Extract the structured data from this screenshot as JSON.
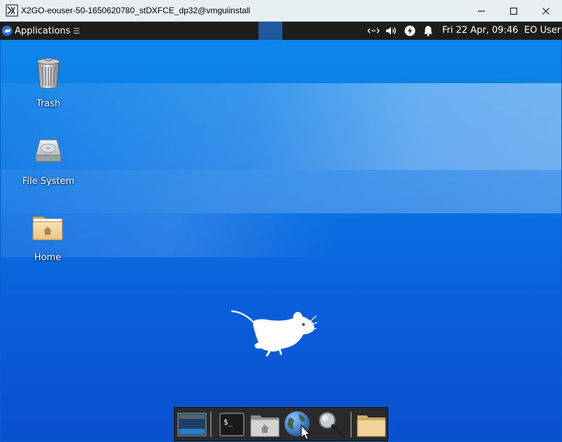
{
  "window": {
    "title": "X2GO-eouser-50-1650620780_stDXFCE_dp32@vmguiinstall",
    "controls": [
      "minimize",
      "maximize",
      "close"
    ]
  },
  "panel": {
    "applications_label": "Applications",
    "menu_glyph": "☰",
    "clock": "Fri 22 Apr, 09:46",
    "user": "EO User",
    "tray_icons": [
      "network-icon",
      "volume-icon",
      "power-icon",
      "notification-bell-icon"
    ]
  },
  "desktop": {
    "icons": [
      {
        "name": "trash",
        "label": "Trash",
        "icon": "trash-icon"
      },
      {
        "name": "file-system",
        "label": "File System",
        "icon": "hard-drive-icon"
      },
      {
        "name": "home",
        "label": "Home",
        "icon": "home-folder-icon"
      }
    ],
    "logo": "xfce-mouse-logo"
  },
  "dock": {
    "items": [
      {
        "name": "show-desktop",
        "icon": "show-desktop-icon"
      },
      {
        "name": "terminal",
        "icon": "terminal-icon"
      },
      {
        "name": "home-folder",
        "icon": "home-folder-icon"
      },
      {
        "name": "web-browser",
        "icon": "globe-icon"
      },
      {
        "name": "app-finder",
        "icon": "magnifier-icon"
      },
      {
        "name": "folder",
        "icon": "folder-icon"
      }
    ]
  },
  "colors": {
    "desktop_blue": "#0a72e4",
    "panel_bg": "#1d1d1d",
    "workspace_active": "#1f5aa0"
  }
}
